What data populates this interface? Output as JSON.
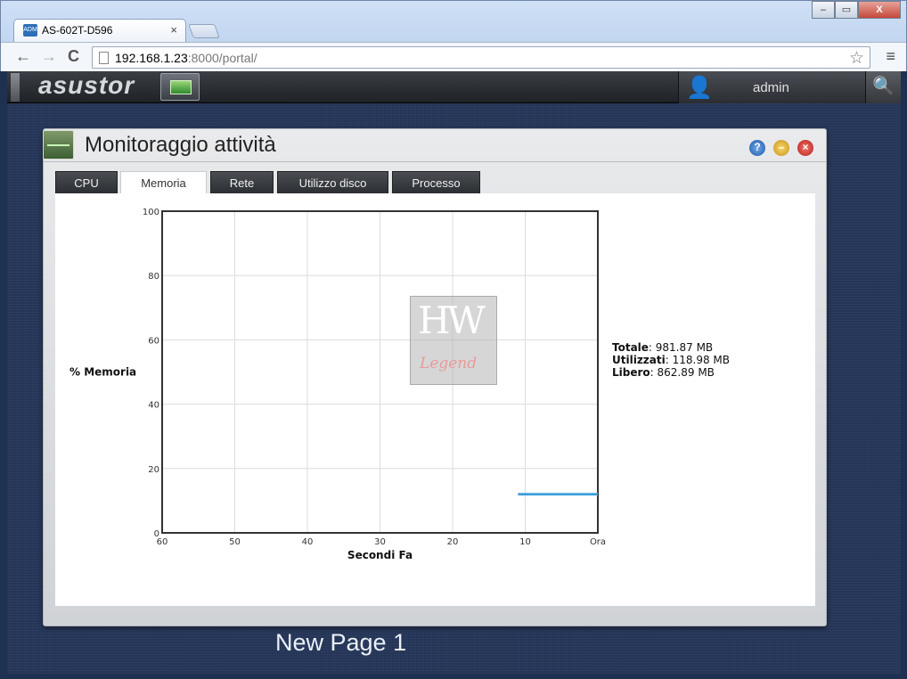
{
  "browser": {
    "tab_title": "AS-602T-D596",
    "tab_favicon_text": "ADM",
    "tab_close": "×",
    "url_host": "192.168.1.23",
    "url_path": ":8000/portal/",
    "back_icon": "←",
    "forward_icon": "→",
    "reload_icon": "C",
    "star_icon": "☆",
    "menu_icon": "≡",
    "minimize_icon": "–",
    "maximize_icon": "▭",
    "close_icon": "X"
  },
  "appbar": {
    "logo": "asustor",
    "user": "admin",
    "user_icon": "👤",
    "search_icon": "🔍"
  },
  "window": {
    "title": "Monitoraggio attività",
    "help": "?",
    "minimize": "–",
    "close": "×",
    "tabs": [
      {
        "label": "CPU",
        "active": false
      },
      {
        "label": "Memoria",
        "active": true
      },
      {
        "label": "Rete",
        "active": false
      },
      {
        "label": "Utilizzo disco",
        "active": false
      },
      {
        "label": "Processo",
        "active": false
      }
    ]
  },
  "stats": {
    "totale_label": "Totale",
    "totale_value": ": 981.87 MB",
    "utilizzati_label": "Utilizzati",
    "utilizzati_value": ": 118.98 MB",
    "libero_label": "Libero",
    "libero_value": ": 862.89 MB"
  },
  "watermark": {
    "top": "HW",
    "bottom": "Legend"
  },
  "page_label": "New Page 1",
  "chart_data": {
    "type": "line",
    "ylabel": "% Memoria",
    "xlabel": "Secondi Fa",
    "x_ticks": [
      "60",
      "50",
      "40",
      "30",
      "20",
      "10",
      "Ora"
    ],
    "y_ticks": [
      "100",
      "80",
      "60",
      "40",
      "20",
      "0"
    ],
    "xlim": [
      60,
      0
    ],
    "ylim": [
      0,
      100
    ],
    "grid": true,
    "series": [
      {
        "x": [
          11,
          0
        ],
        "y": [
          12,
          12
        ],
        "color": "#1e8fd6"
      }
    ]
  }
}
